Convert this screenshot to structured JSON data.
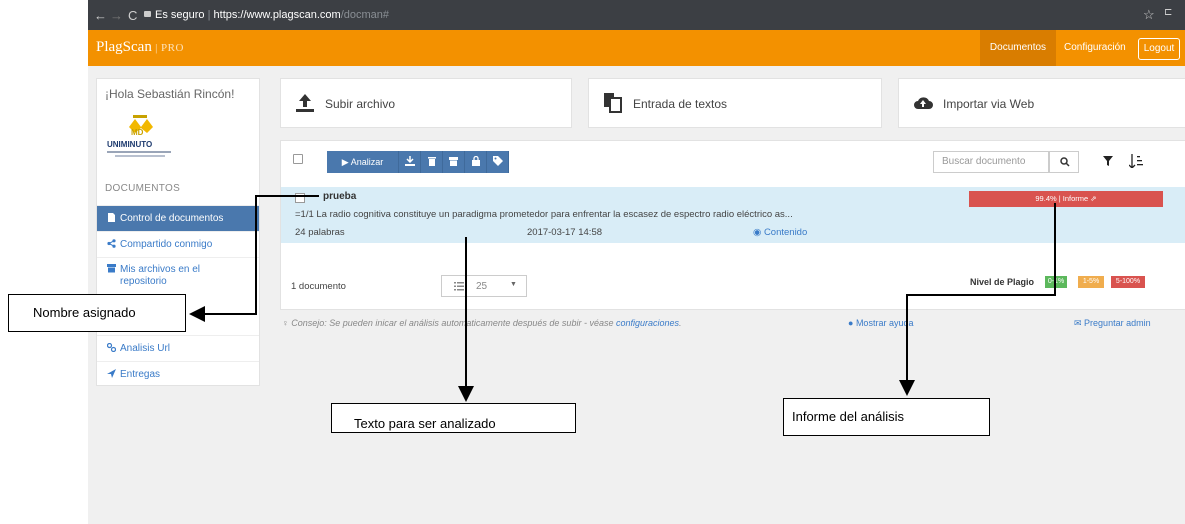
{
  "browser": {
    "url_secure": "Es seguro",
    "url_host": "https://www.plagscan.com",
    "url_path": "/docman#"
  },
  "header": {
    "logo": "PlagScan",
    "logo_suffix": "PRO",
    "nav": [
      "Documentos",
      "Configuración",
      "Logout"
    ],
    "accent": "#f39100"
  },
  "sidebar": {
    "greeting": "¡Hola Sebastián Rincón!",
    "logo_text": "UNIMINUTO",
    "section_header": "DOCUMENTOS",
    "items": [
      {
        "label": "Control de documentos",
        "icon": "file-icon"
      },
      {
        "label": "Compartido conmigo",
        "icon": "share-icon"
      },
      {
        "label": "Mis archivos en el repositorio",
        "icon": "archive-icon"
      },
      {
        "label": "Analisis Url",
        "icon": "link-icon"
      },
      {
        "label": "Entregas",
        "icon": "send-icon"
      }
    ]
  },
  "cards": [
    {
      "label": "Subir archivo",
      "icon": "upload-icon"
    },
    {
      "label": "Entrada de textos",
      "icon": "copy-icon"
    },
    {
      "label": "Importar via Web",
      "icon": "cloud-upload-icon"
    }
  ],
  "toolbar": {
    "analyze": "Analizar",
    "search_placeholder": "Buscar documento"
  },
  "document": {
    "name": "prueba",
    "excerpt": "=1/1 La radio cognitiva constituye un paradigma prometedor para enfrentar la escasez de espectro radio eléctrico as...",
    "words": "24  palabras",
    "date": "2017-03-17 14:58",
    "content_link": "Contenido",
    "report": "99.4% | Informe",
    "report_color": "#d9534f"
  },
  "footer": {
    "count": "1 documento",
    "page_size": "25",
    "plag_level_label": "Nivel de Plagio",
    "badges": [
      {
        "label": "0-1%",
        "color": "#5cb85c"
      },
      {
        "label": "1-5%",
        "color": "#f0ad4e"
      },
      {
        "label": "5-100%",
        "color": "#d9534f"
      }
    ]
  },
  "tip": {
    "text": "Consejo: Se pueden inicar el análisis automaticamente después de subir - véase ",
    "link": "configuraciones",
    "end": ".",
    "help": "Mostrar ayuda",
    "ask_admin": "Preguntar admin"
  },
  "annotations": {
    "name": "Nombre asignado",
    "text": "Texto para ser analizado",
    "report": "Informe del análisis"
  }
}
